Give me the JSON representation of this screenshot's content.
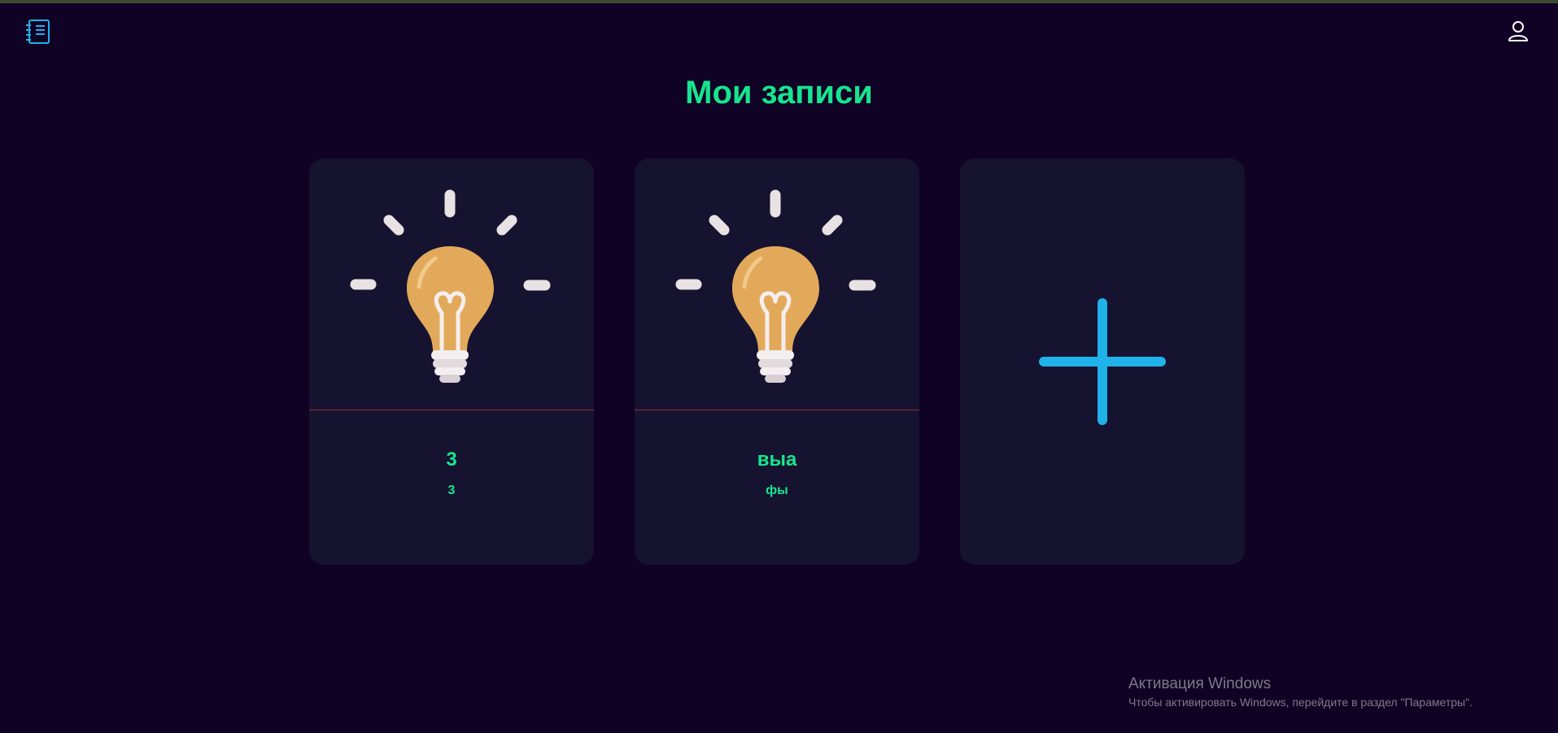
{
  "header": {
    "title": "Мои записи",
    "notebook_icon": "notebook-icon",
    "user_icon": "user-icon"
  },
  "notes": [
    {
      "title": "3",
      "text": "3",
      "icon": "lightbulb-icon"
    },
    {
      "title": "выа",
      "text": "фы",
      "icon": "lightbulb-icon"
    }
  ],
  "add_card": {
    "icon": "plus-icon"
  },
  "watermark": {
    "title": "Активация Windows",
    "text": "Чтобы активировать Windows, перейдите в раздел \"Параметры\"."
  },
  "colors": {
    "background": "#100225",
    "card": "#161330",
    "accent_green": "#16e58e",
    "accent_blue": "#1fb3ea",
    "divider": "#9c2a33",
    "bulb": "#e3a95a"
  }
}
